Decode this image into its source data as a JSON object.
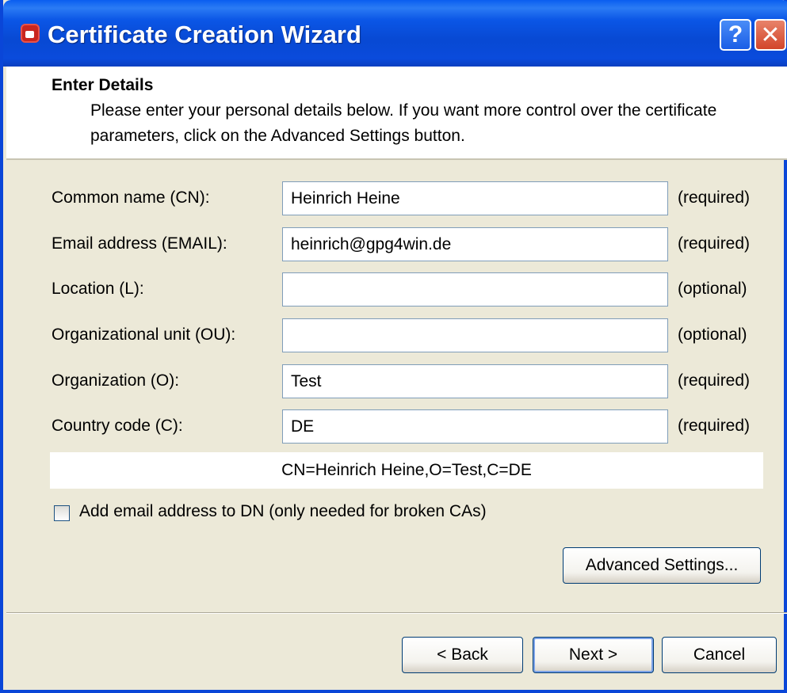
{
  "window": {
    "title": "Certificate Creation Wizard",
    "help_label": "?",
    "close_label": "✕"
  },
  "header": {
    "title": "Enter Details",
    "description": "Please enter your personal details below. If you want more control over the certificate parameters, click on the Advanced Settings button."
  },
  "form": {
    "fields": [
      {
        "label": "Common name (CN):",
        "value": "Heinrich Heine",
        "status": "(required)"
      },
      {
        "label": "Email address (EMAIL):",
        "value": "heinrich@gpg4win.de",
        "status": "(required)"
      },
      {
        "label": "Location (L):",
        "value": "",
        "status": "(optional)"
      },
      {
        "label": "Organizational unit (OU):",
        "value": "",
        "status": "(optional)"
      },
      {
        "label": "Organization (O):",
        "value": "Test",
        "status": "(required)"
      },
      {
        "label": "Country code (C):",
        "value": "DE",
        "status": "(required)"
      }
    ],
    "dn_preview": "CN=Heinrich Heine,O=Test,C=DE",
    "checkbox_label": "Add email address to DN (only needed for broken CAs)",
    "checkbox_checked": false,
    "advanced_button": "Advanced Settings..."
  },
  "footer": {
    "back_label": "< Back",
    "next_label": "Next >",
    "cancel_label": "Cancel"
  }
}
